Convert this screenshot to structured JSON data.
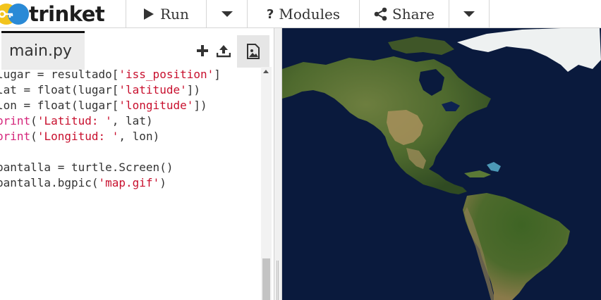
{
  "brand": {
    "name": "trinket"
  },
  "toolbar": {
    "run_label": "Run",
    "modules_label": "Modules",
    "share_label": "Share"
  },
  "editor": {
    "file_tab": "main.py",
    "lines": [
      [
        {
          "t": "lugar = resultado["
        },
        {
          "t": "'iss_position'",
          "c": "str"
        },
        {
          "t": "]"
        }
      ],
      [
        {
          "t": "lat = float(lugar["
        },
        {
          "t": "'latitude'",
          "c": "str"
        },
        {
          "t": "])"
        }
      ],
      [
        {
          "t": "lon = float(lugar["
        },
        {
          "t": "'longitude'",
          "c": "str"
        },
        {
          "t": "])"
        }
      ],
      [
        {
          "t": "print",
          "c": "kw"
        },
        {
          "t": "("
        },
        {
          "t": "'Latitud: '",
          "c": "str"
        },
        {
          "t": ", lat)"
        }
      ],
      [
        {
          "t": "print",
          "c": "kw"
        },
        {
          "t": "("
        },
        {
          "t": "'Longitud: '",
          "c": "str"
        },
        {
          "t": ", lon)"
        }
      ],
      [],
      [
        {
          "t": "pantalla = turtle.Screen()"
        }
      ],
      [
        {
          "t": "pantalla.bgpic("
        },
        {
          "t": "'map.gif'",
          "c": "str"
        },
        {
          "t": ")"
        }
      ]
    ]
  },
  "icons": {
    "run": "play-icon",
    "modules": "question-icon",
    "share": "share-icon",
    "add_file": "plus-icon",
    "upload": "upload-icon",
    "image": "image-icon"
  },
  "colors": {
    "ocean": "#0a1a3d",
    "land": "#4f6a2e",
    "desert": "#a8905c",
    "ice": "#f2f4f4",
    "string": "#c8102e",
    "keyword": "#d4247a"
  }
}
